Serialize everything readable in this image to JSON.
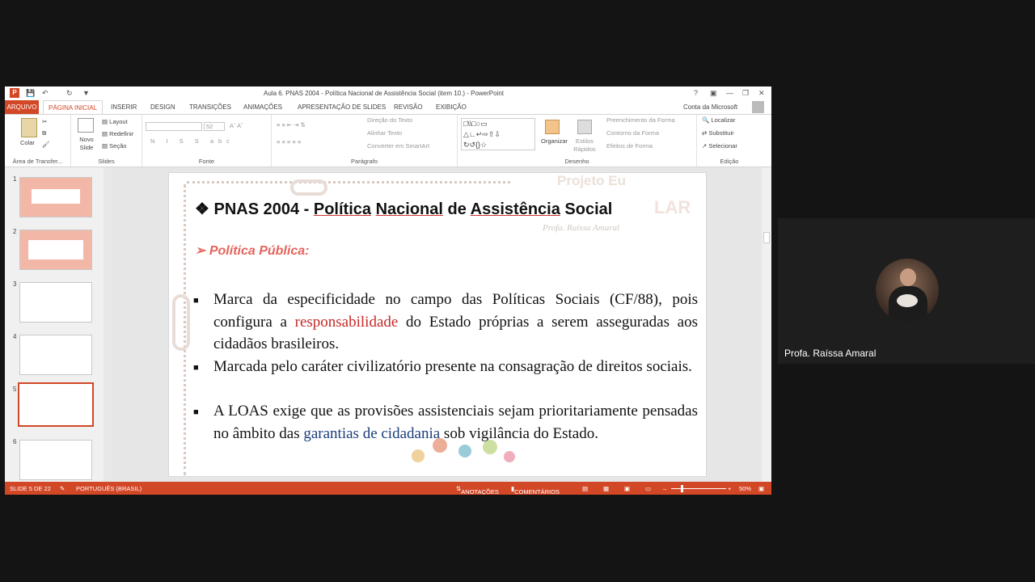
{
  "window": {
    "title": "Aula 6. PNAS 2004 - Política Nacional de Assistência Social  (item 10.) - PowerPoint",
    "account": "Conta da Microsoft"
  },
  "tabs": [
    "ARQUIVO",
    "PÁGINA INICIAL",
    "INSERIR",
    "DESIGN",
    "TRANSIÇÕES",
    "ANIMAÇÕES",
    "APRESENTAÇÃO DE SLIDES",
    "REVISÃO",
    "EXIBIÇÃO"
  ],
  "ribbon": {
    "clipboard": {
      "paste": "Colar",
      "group": "Área de Transfer..."
    },
    "slides": {
      "new_slide": "Novo Slide",
      "layout": "Layout",
      "reset": "Redefinir",
      "section": "Seção",
      "group": "Slides"
    },
    "font": {
      "font_size": "52",
      "group": "Fonte"
    },
    "paragraph": {
      "text_direction": "Direção do Texto",
      "align_text": "Alinhar Texto",
      "smartart": "Converter em SmartArt",
      "group": "Parágrafo"
    },
    "drawing": {
      "arrange": "Organizar",
      "quick_styles": "Estilos Rápidos",
      "shape_fill": "Preenchimento da Forma",
      "shape_outline": "Contorno da Forma",
      "shape_effects": "Efeitos de Forma",
      "group": "Desenho"
    },
    "editing": {
      "find": "Localizar",
      "replace": "Substituir",
      "select": "Selecionar",
      "group": "Edição"
    }
  },
  "thumbnails": [
    "1",
    "2",
    "3",
    "4",
    "5",
    "6"
  ],
  "selected_slide": 5,
  "slide": {
    "watermark_1": "Projeto Eu",
    "watermark_2": "LAR",
    "watermark_3": "Profa. Raíssa Amaral",
    "title_prefix": "❖ PNAS 2004 - ",
    "title_w1": "Política",
    "title_w2": "Nacional",
    "title_w3": "de",
    "title_w4": "Assistência",
    "title_w5": "Social",
    "subtitle": "➢ Política Pública:",
    "b1_pre": "Marca da especificidade no campo das Políticas Sociais (CF/88), pois configura a ",
    "b1_hl": "responsabilidade",
    "b1_post": " do Estado próprias a serem asseguradas aos cidadãos brasileiros.",
    "b2": "Marcada pelo caráter civilizatório presente na consagração de direitos sociais.",
    "b3_pre": "A LOAS exige que as provisões assistenciais sejam prioritariamente pensadas no âmbito das ",
    "b3_hl": "garantias de cidadania",
    "b3_post": " sob vigilância do Estado.",
    "bullet_glyph": "■"
  },
  "status": {
    "slide_of": "SLIDE 5 DE 22",
    "language": "PORTUGUÊS (BRASIL)",
    "notes": "ANOTAÇÕES",
    "comments": "COMENTÁRIOS",
    "zoom": "50%"
  },
  "participant": {
    "name": "Profa. Raíssa Amaral"
  },
  "colors": {
    "accent": "#d24726",
    "highlight_red": "#c62828",
    "highlight_blue": "#1a3d7c"
  }
}
